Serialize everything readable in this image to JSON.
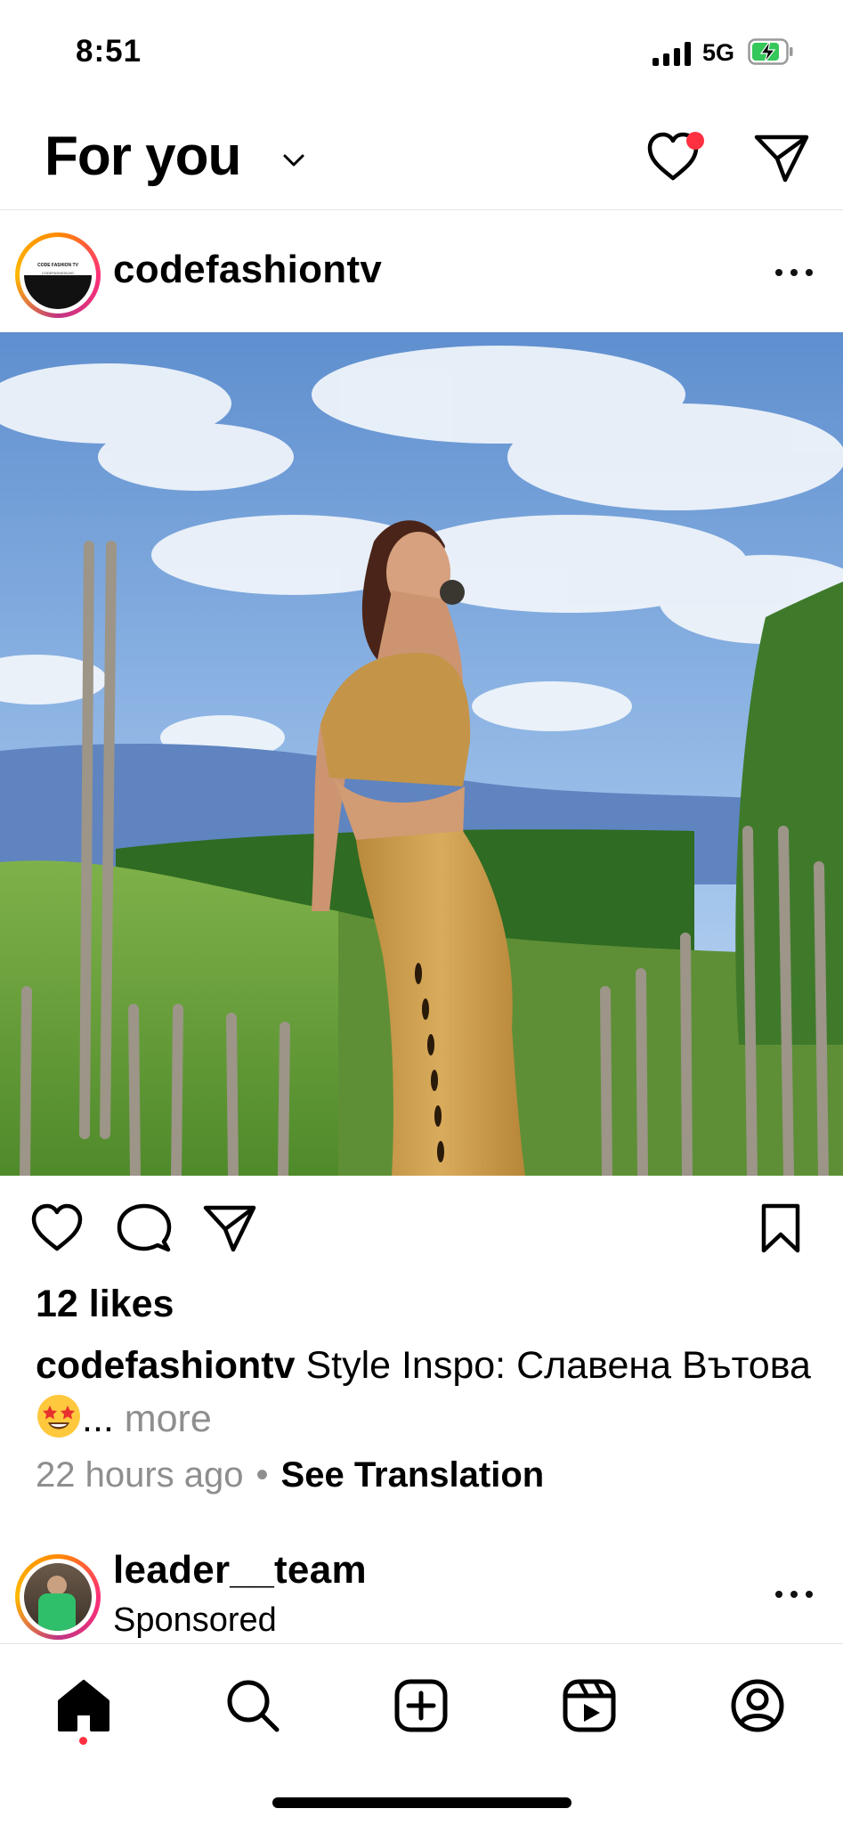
{
  "status_bar": {
    "time": "8:51",
    "network": "5G",
    "battery": "charging"
  },
  "header": {
    "title": "For you",
    "icons": [
      "chevron-down-icon",
      "heart-icon",
      "direct-message-icon"
    ]
  },
  "post": {
    "username": "codefashiontv",
    "avatar_text": {
      "line1": "CODE FASHION TV",
      "line2": "CODEFASHION.BG"
    },
    "likes": "12 likes",
    "caption_username": "codefashiontv",
    "caption_text": " Style Inspo: Славена Вътова ",
    "caption_emoji": "star-struck-emoji",
    "ellipsis": "...",
    "more_label": "more",
    "time_ago": "22 hours ago",
    "separator": "•",
    "translate_label": "See Translation"
  },
  "sponsored_post": {
    "username": "leader__team",
    "label": "Sponsored"
  },
  "bottom_nav": {
    "items": [
      "home-icon",
      "search-icon",
      "create-icon",
      "reels-icon",
      "profile-icon"
    ],
    "active": "home-icon"
  },
  "colors": {
    "notification_dot": "#ff3040",
    "muted_text": "#8e8e8e",
    "text": "#000000"
  }
}
